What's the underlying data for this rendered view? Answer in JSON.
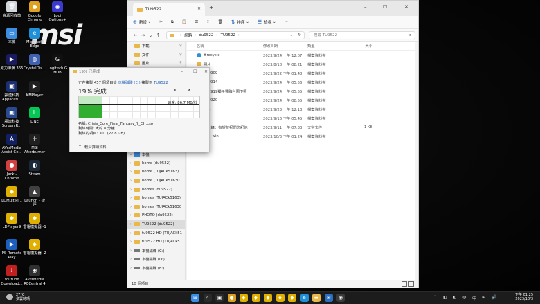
{
  "desktop": {
    "logo": "msi",
    "icons": [
      {
        "label": "資源回收筒",
        "color": "#d0d6dc",
        "glyph": "🗑"
      },
      {
        "label": "Google Chrome",
        "color": "#e0a020",
        "glyph": "●"
      },
      {
        "label": "Logi Options+",
        "color": "#3a3ad0",
        "glyph": "◉"
      },
      {
        "label": "本機",
        "color": "#3d8ee0",
        "glyph": "▭"
      },
      {
        "label": "Microsoft Edge",
        "color": "#1f8fd8",
        "glyph": "e"
      },
      {
        "label": "Steam",
        "color": "#1b2838",
        "glyph": "◐"
      },
      {
        "label": "威力導演 365",
        "color": "#1a1a60",
        "glyph": "▶"
      },
      {
        "label": "CrystalDis...",
        "color": "#4060b0",
        "glyph": "◍"
      },
      {
        "label": "Logitech G HUB",
        "color": "#101010",
        "glyph": "G"
      },
      {
        "label": "訊連科技 Applicati...",
        "color": "#1a3070",
        "glyph": "▣"
      },
      {
        "label": "KMPlayer",
        "color": "#202020",
        "glyph": "▶"
      },
      {
        "label": "訊連科技 Screen R...",
        "color": "#2a4a90",
        "glyph": "▣"
      },
      {
        "label": "LINE",
        "color": "#06c755",
        "glyph": "L"
      },
      {
        "label": "AVerMedia Assist Ce...",
        "color": "#102060",
        "glyph": "A"
      },
      {
        "label": "MSI Afterburner",
        "color": "#202020",
        "glyph": "✈"
      },
      {
        "label": "Jack - Chrome",
        "color": "#d04040",
        "glyph": "●"
      },
      {
        "label": "Steam",
        "color": "#1b2838",
        "glyph": "◐"
      },
      {
        "label": "LDMultiPl...",
        "color": "#e0b000",
        "glyph": "◆"
      },
      {
        "label": "Launch - 捷徑",
        "color": "#404040",
        "glyph": "▲"
      },
      {
        "label": "LDPlayer9",
        "color": "#e0b000",
        "glyph": "◆"
      },
      {
        "label": "雷電模擬器 -1",
        "color": "#e0b000",
        "glyph": "◆"
      },
      {
        "label": "PS Remote Play",
        "color": "#1d5fbf",
        "glyph": "▶"
      },
      {
        "label": "雷電模擬器 -2",
        "color": "#e0b000",
        "glyph": "◆"
      },
      {
        "label": "Youtube Download...",
        "color": "#c02020",
        "glyph": "↓"
      },
      {
        "label": "AVerMedia RECentral 4",
        "color": "#303030",
        "glyph": "◉"
      }
    ]
  },
  "explorer": {
    "tab_title": "TU9522",
    "new_tab": "+",
    "window_controls": {
      "minimize": "–",
      "maximize": "☐",
      "close": "✕"
    },
    "toolbar": {
      "new": "新增",
      "cut": "✂",
      "copy": "⧉",
      "paste": "📋",
      "rename": "⎚",
      "share": "⇪",
      "delete": "🗑",
      "sort": "排序",
      "view": "檢視",
      "more": "···"
    },
    "address": {
      "parts": [
        "網路",
        "du9522",
        "TU9522"
      ],
      "refresh": "↻"
    },
    "search_placeholder": "搜尋 TU9522",
    "nav_quick": [
      {
        "label": "下載"
      },
      {
        "label": "文件"
      },
      {
        "label": "圖片"
      },
      {
        "label": "音樂"
      },
      {
        "label": "影片"
      }
    ],
    "nav_tree": [
      {
        "label": "本機",
        "kind": "pc"
      },
      {
        "label": "home (du9522)",
        "kind": "folder"
      },
      {
        "label": "home (TUJACk5163)",
        "kind": "folder"
      },
      {
        "label": "home (TUJACk516301",
        "kind": "folder"
      },
      {
        "label": "homes (du9522)",
        "kind": "folder"
      },
      {
        "label": "homes (TUJACk5163)",
        "kind": "folder"
      },
      {
        "label": "homes (TUJACk51630",
        "kind": "folder"
      },
      {
        "label": "PHOTO (du9522)",
        "kind": "folder"
      },
      {
        "label": "TU9522 (du9522)",
        "kind": "folder",
        "selected": true
      },
      {
        "label": "tu9522 HD (TUJACk51",
        "kind": "folder"
      },
      {
        "label": "tu9522 HD (TUJACk51",
        "kind": "folder"
      },
      {
        "label": "本機磁碟 (C:)",
        "kind": "drive"
      },
      {
        "label": "本機磁碟 (D:)",
        "kind": "drive"
      },
      {
        "label": "本機磁碟 (E:)",
        "kind": "drive"
      }
    ],
    "columns": {
      "name": "名稱",
      "date": "修改日期",
      "type": "類型",
      "size": "大小"
    },
    "files": [
      {
        "name": "#recycle",
        "date": "2023/9/24 上午 12:07",
        "type": "檔案資料夾",
        "size": "",
        "kind": "rec"
      },
      {
        "name": "照片",
        "date": "2023/8/18 上午 08:21",
        "type": "檔案資料夾",
        "size": "",
        "kind": "folder"
      },
      {
        "name": "230909",
        "date": "2023/9/22 下午 01:48",
        "type": "檔案資料夾",
        "size": "",
        "kind": "folder"
      },
      {
        "name": "230914",
        "date": "2023/9/24 上午 05:56",
        "type": "檔案資料夾",
        "size": "",
        "kind": "folder"
      },
      {
        "name": "230919獨子豐胸台圖下照",
        "date": "2023/9/24 上午 05:55",
        "type": "檔案資料夾",
        "size": "",
        "kind": "folder"
      },
      {
        "name": "230920",
        "date": "2023/9/24 上午 08:55",
        "type": "檔案資料夾",
        "size": "",
        "kind": "folder"
      },
      {
        "name": "資料",
        "date": "2023/9/23 上午 12:13",
        "type": "檔案資料夾",
        "size": "",
        "kind": "folder"
      },
      {
        "name": "影片",
        "date": "2023/9/16 下午 05:45",
        "type": "檔案資料夾",
        "size": "",
        "kind": "folder"
      },
      {
        "name": "備忘錄：有望敬祝們您記他",
        "date": "2023/9/11 上午 07:33",
        "type": "文字文件",
        "size": "1 KB",
        "kind": "txt"
      },
      {
        "name": "app_win",
        "date": "2023/10/3 下午 01:24",
        "type": "檔案資料夾",
        "size": "",
        "kind": "folder"
      }
    ],
    "status": "10 個項目"
  },
  "copy_dialog": {
    "title": "19% 已完成",
    "line1_prefix": "正在複製 457 個項目從",
    "line1_source": "本機磁碟 (E:)",
    "line1_mid": "複製到",
    "line1_dest": "TU9522",
    "percent_text": "19% 完成",
    "progress_fraction": 0.19,
    "speed": "速度: 86.7 MB/秒",
    "name_line": "名稱: Crisis_Core_Final_Fantasy_7_CH.cso",
    "time_line": "剩餘時間: 大約 8 分鐘",
    "items_line": "剩餘的項目: 301 (27.8 GB)",
    "less_details": "較少詳細資料",
    "pause": "⏸",
    "cancel": "✕"
  },
  "taskbar": {
    "temp": "27°C",
    "weather": "多雲時晴",
    "apps": [
      {
        "name": "start",
        "glyph": "⊞",
        "color": "#3a8ee6"
      },
      {
        "name": "search",
        "glyph": "⌕",
        "color": "#2a2a2a"
      },
      {
        "name": "taskview",
        "glyph": "▣",
        "color": "#2a2a2a"
      },
      {
        "name": "chrome",
        "glyph": "●",
        "color": "#d9a020"
      },
      {
        "name": "app-ld1",
        "glyph": "◆",
        "color": "#e0b000"
      },
      {
        "name": "app-ld2",
        "glyph": "◆",
        "color": "#e0b000"
      },
      {
        "name": "app-ld3",
        "glyph": "◆",
        "color": "#e0b000"
      },
      {
        "name": "app-ld4",
        "glyph": "◆",
        "color": "#e0b000"
      },
      {
        "name": "app-ld5",
        "glyph": "◆",
        "color": "#e0b000"
      },
      {
        "name": "edge",
        "glyph": "e",
        "color": "#1f8fd8"
      },
      {
        "name": "explorer",
        "glyph": "▬",
        "color": "#e8b84a"
      },
      {
        "name": "mail",
        "glyph": "✉",
        "color": "#2a6fc0"
      },
      {
        "name": "obs",
        "glyph": "◉",
        "color": "#3a3a3a"
      }
    ],
    "tray": [
      "^",
      "◧",
      "◐",
      "◍",
      "中",
      "⊕",
      "🔊"
    ],
    "time": "下午 01:25",
    "date": "2023/10/3"
  }
}
